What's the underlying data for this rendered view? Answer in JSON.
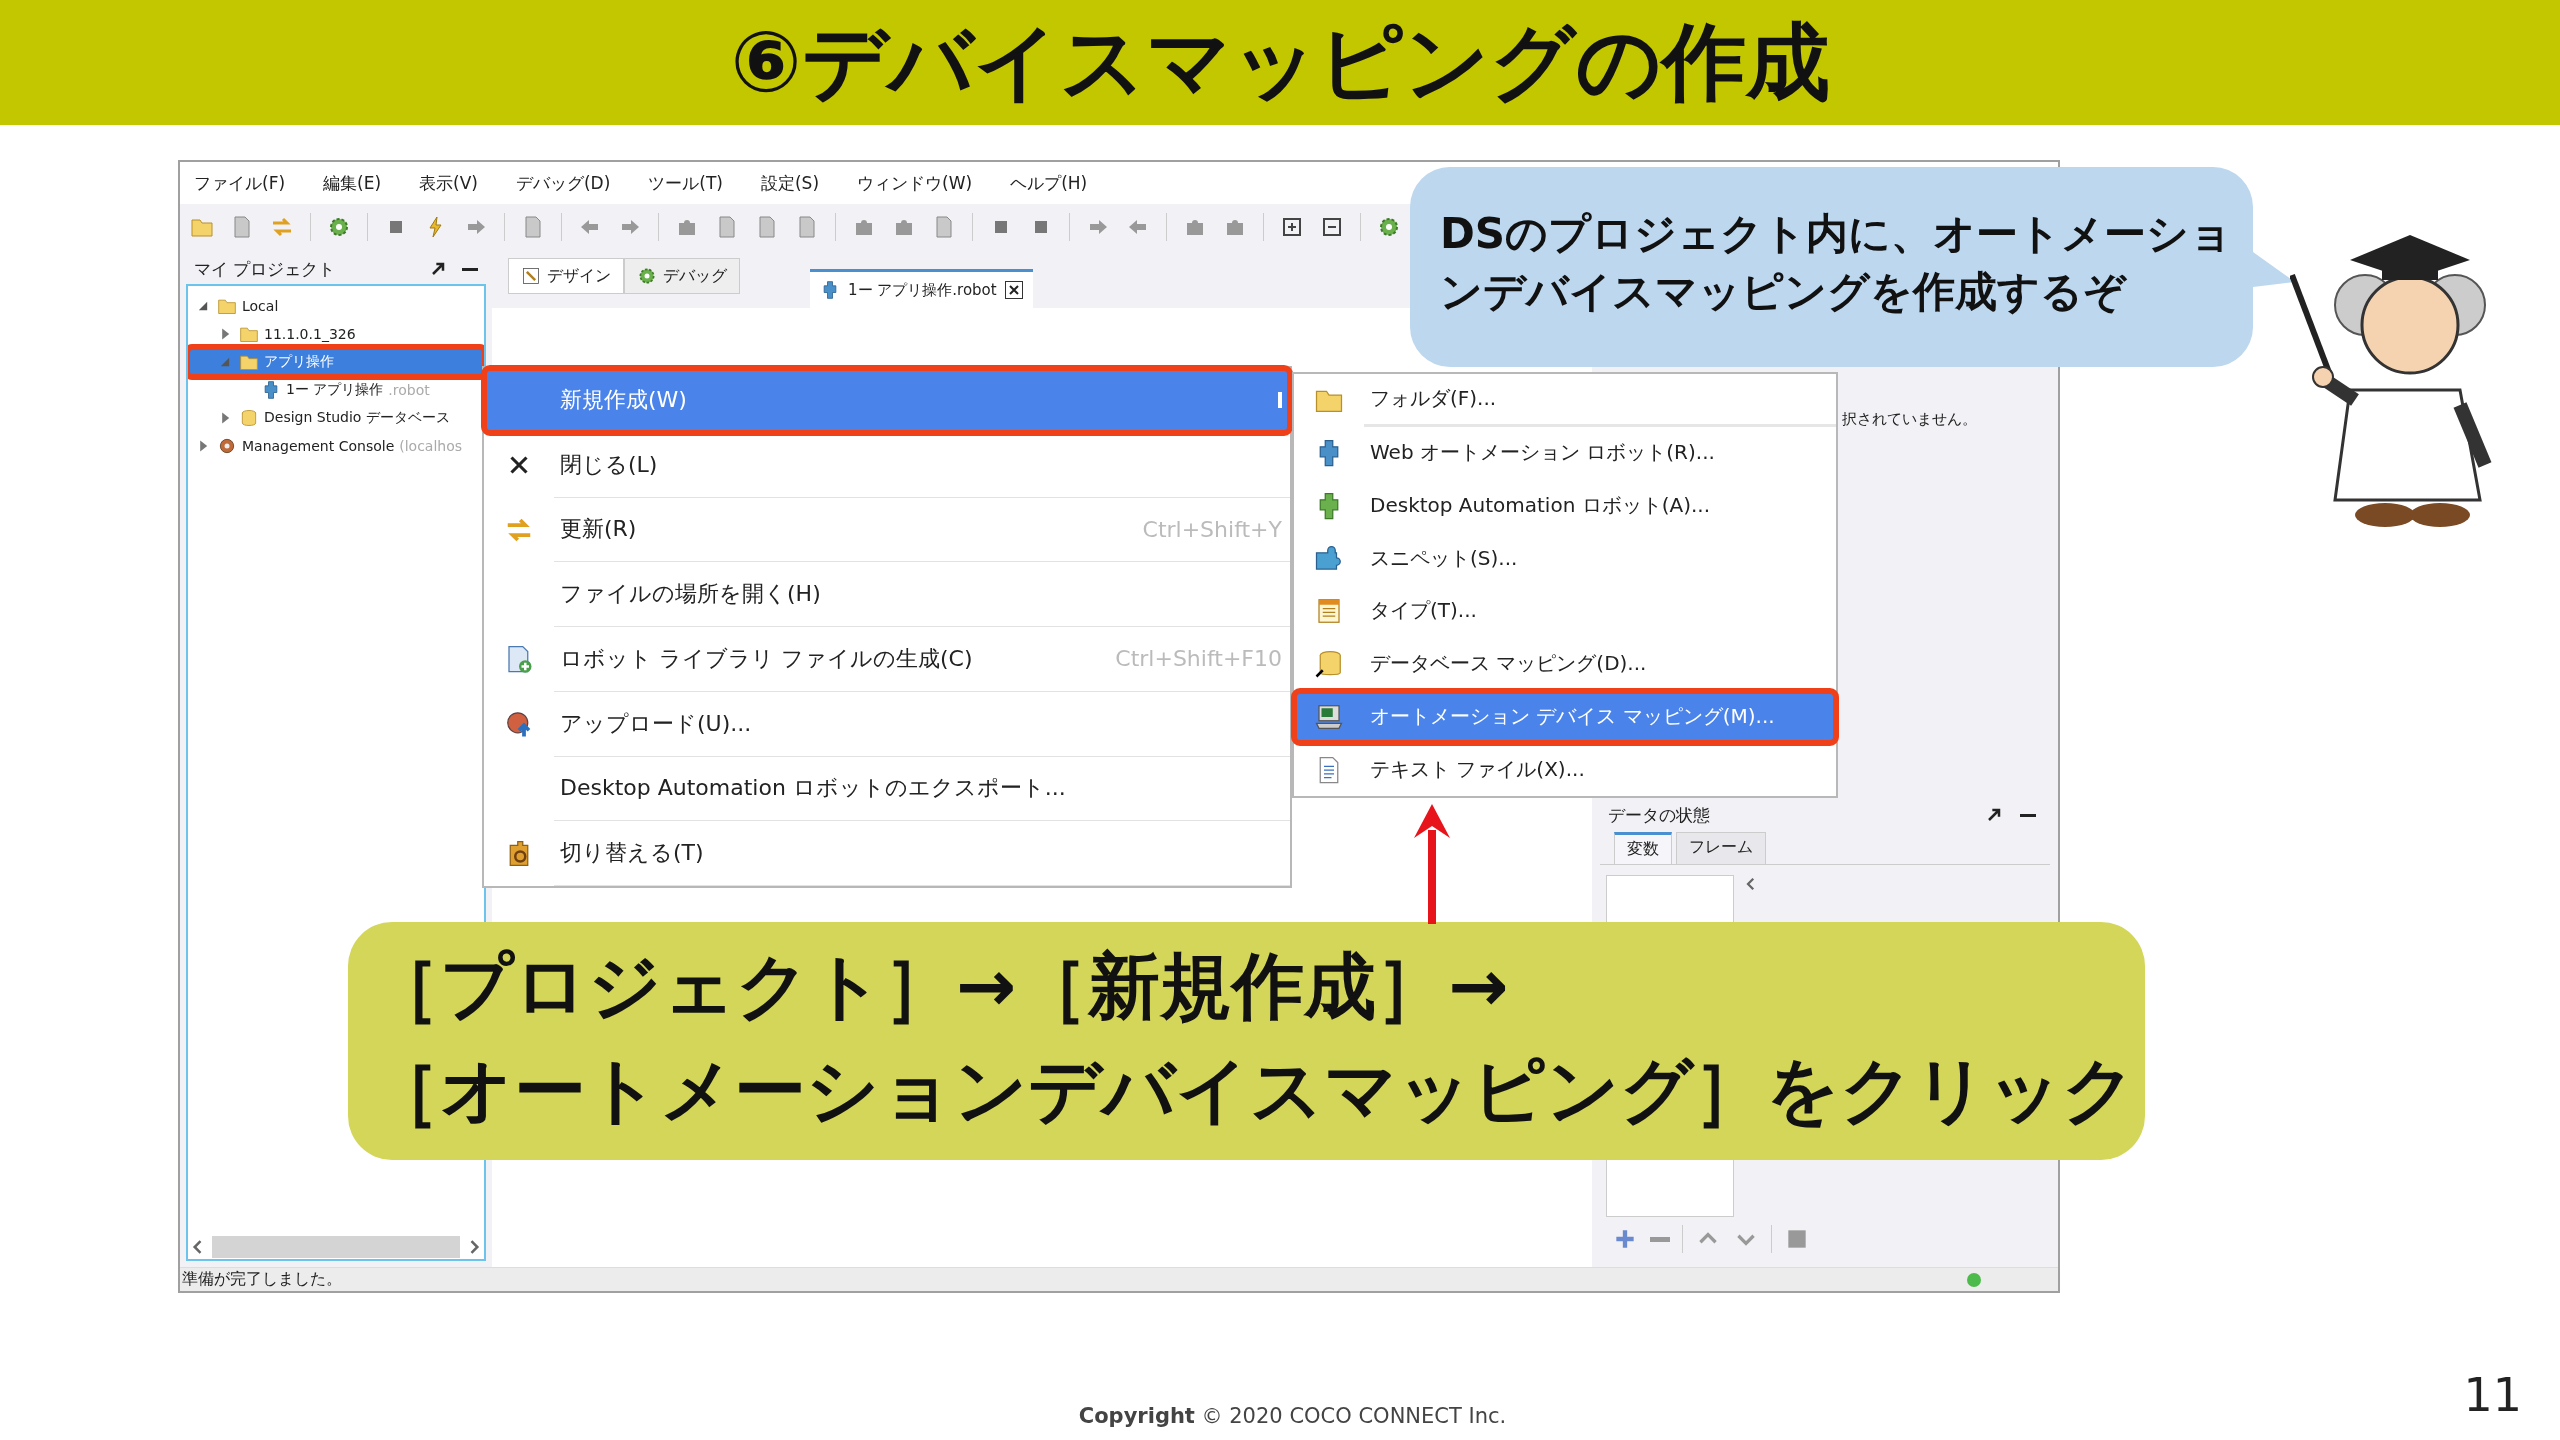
{
  "slide_title": "⑥デバイスマッピングの作成",
  "app": {
    "menu_bar": [
      "ファイル(F)",
      "編集(E)",
      "表示(V)",
      "デバッグ(D)",
      "ツール(T)",
      "設定(S)",
      "ウィンドウ(W)",
      "ヘルプ(H)"
    ],
    "projects_panel": {
      "title": "マイ プロジェクト",
      "tree": [
        {
          "label": "Local",
          "expanded": true,
          "selected": false,
          "highlighted": false,
          "children": [
            {
              "label": "11.1.0.1_326",
              "expanded": false,
              "selected": false,
              "highlighted": false
            },
            {
              "label": "アプリ操作",
              "expanded": true,
              "selected": true,
              "highlighted": true,
              "children": [
                {
                  "label": "1ー アプリ操作",
                  "suffix": ".robot",
                  "selected": false,
                  "highlighted": false
                }
              ]
            },
            {
              "label": "Design Studio データベース",
              "expanded": false,
              "selected": false,
              "highlighted": false
            }
          ]
        },
        {
          "label": "Management Console",
          "suffix": " (localhos",
          "expanded": false,
          "selected": false,
          "highlighted": false
        }
      ]
    },
    "perspective_tabs": [
      {
        "label": "デザイン",
        "selected": true
      },
      {
        "label": "デバッグ",
        "selected": false
      }
    ],
    "editor_tabs": [
      {
        "label": "1ー アプリ操作.robot",
        "selected": true
      }
    ],
    "properties_message": "択されていません。",
    "data_state_panel": {
      "title": "データの状態",
      "tabs": [
        {
          "label": "変数",
          "selected": true
        },
        {
          "label": "フレーム",
          "selected": false
        }
      ]
    },
    "status_bar": {
      "message": "準備が完了しました。"
    }
  },
  "context_menu": {
    "items": [
      {
        "label": "新規作成(W)",
        "selected": true,
        "highlighted": true,
        "submenu": true
      },
      {
        "label": "閉じる(L)",
        "selected": false,
        "highlighted": false
      },
      {
        "label": "更新(R)",
        "shortcut": "Ctrl+Shift+Y",
        "selected": false,
        "highlighted": false
      },
      {
        "label": "ファイルの場所を開く(H)",
        "selected": false,
        "highlighted": false
      },
      {
        "label": "ロボット ライブラリ ファイルの生成(C)",
        "shortcut": "Ctrl+Shift+F10",
        "selected": false,
        "highlighted": false
      },
      {
        "label": "アップロード(U)...",
        "selected": false,
        "highlighted": false
      },
      {
        "label": "Desktop Automation ロボットのエクスポート...",
        "selected": false,
        "highlighted": false
      },
      {
        "label": "切り替える(T)",
        "selected": false,
        "highlighted": false
      }
    ]
  },
  "submenu": {
    "items": [
      {
        "label": "フォルダ(F)...",
        "selected": false,
        "highlighted": false,
        "separator_after": true
      },
      {
        "label": "Web オートメーション ロボット(R)...",
        "selected": false,
        "highlighted": false,
        "separator_after": false
      },
      {
        "label": "Desktop Automation ロボット(A)...",
        "selected": false,
        "highlighted": false,
        "separator_after": false
      },
      {
        "label": "スニペット(S)...",
        "selected": false,
        "highlighted": false,
        "separator_after": false
      },
      {
        "label": "タイプ(T)...",
        "selected": false,
        "highlighted": false,
        "separator_after": false
      },
      {
        "label": "データベース マッピング(D)...",
        "selected": false,
        "highlighted": false,
        "separator_after": false
      },
      {
        "label": "オートメーション デバイス マッピング(M)...",
        "selected": true,
        "highlighted": true,
        "separator_after": false
      },
      {
        "label": "テキスト ファイル(X)...",
        "selected": false,
        "highlighted": false,
        "separator_after": false
      }
    ]
  },
  "speech_bubble": {
    "lines": [
      "DSのプロジェクト内に、オートメーショ",
      "ンデバイスマッピングを作成するぞ"
    ]
  },
  "instruction_banner": {
    "lines": [
      "［プロジェクト］→［新規作成］→",
      "［オートメーションデバイスマッピング］をクリック"
    ]
  },
  "footer": {
    "copyright": "**Copyright** © 2020 COCO CONNECT Inc.",
    "page_number": "11"
  }
}
